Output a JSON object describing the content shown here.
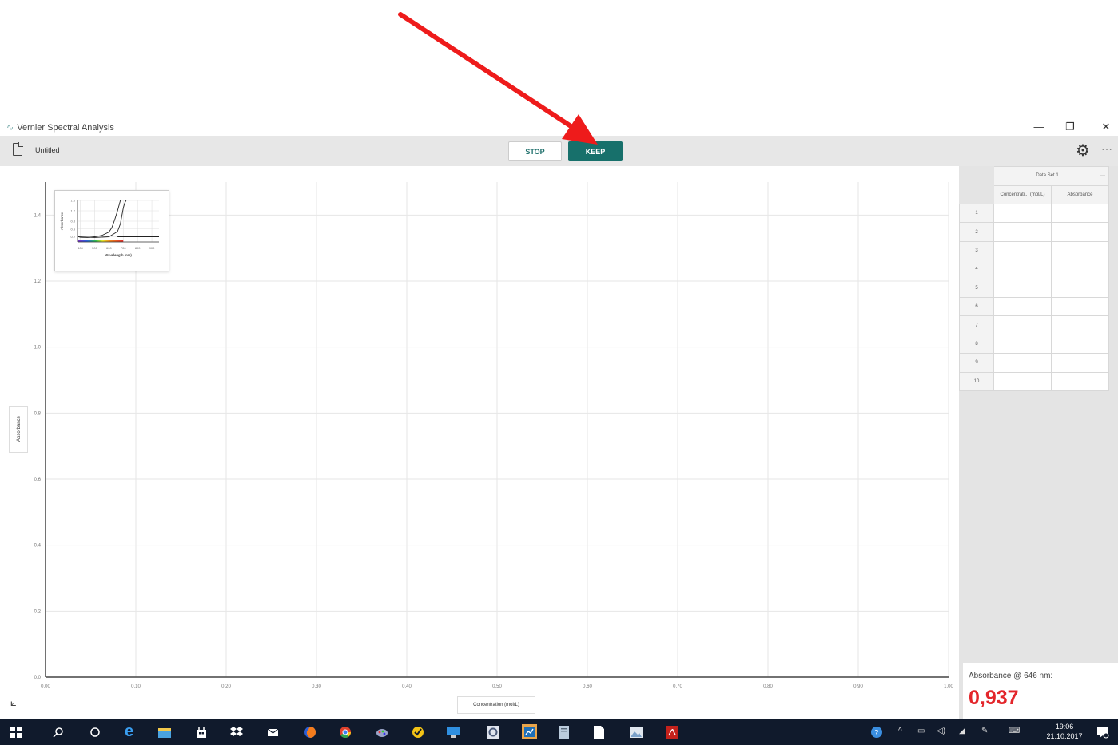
{
  "window": {
    "app_title": "Vernier Spectral Analysis",
    "minimize": "—",
    "maximize": "❐",
    "close": "✕"
  },
  "toolbar": {
    "doc_title": "Untitled",
    "stop_label": "STOP",
    "keep_label": "KEEP",
    "more_label": "⋯",
    "gear_icon": "⚙"
  },
  "graph": {
    "y_axis_label": "Absorbance",
    "x_axis_label": "Concentration (mol/L)",
    "y_ticks": [
      "0.0",
      "0.2",
      "0.4",
      "0.6",
      "0.8",
      "1.0",
      "1.2",
      "1.4"
    ],
    "x_ticks": [
      "0.00",
      "0.10",
      "0.20",
      "0.30",
      "0.40",
      "0.50",
      "0.60",
      "0.70",
      "0.80",
      "0.90",
      "1.00"
    ],
    "tool_icon": "⟀"
  },
  "chart_data": [
    {
      "type": "scatter",
      "xlabel": "Concentration (mol/L)",
      "ylabel": "Absorbance",
      "xlim": [
        0.0,
        1.0
      ],
      "ylim": [
        0.0,
        1.5
      ],
      "x_ticks": [
        "0.00",
        "0.10",
        "0.20",
        "0.30",
        "0.40",
        "0.50",
        "0.60",
        "0.70",
        "0.80",
        "0.90",
        "1.00"
      ],
      "y_ticks": [
        "0.0",
        "0.2",
        "0.4",
        "0.6",
        "0.8",
        "1.0",
        "1.2",
        "1.4"
      ],
      "grid": true,
      "series": []
    },
    {
      "type": "line",
      "xlabel": "Wavelength (nm)",
      "ylabel": "Absorbance",
      "xlim": [
        380,
        950
      ],
      "ylim": [
        0,
        1.6
      ],
      "x_ticks": [
        "400",
        "500",
        "600",
        "700",
        "800",
        "900"
      ],
      "y_ticks": [
        "0.2",
        "0.5",
        "0.8",
        "1.2",
        "1.6"
      ],
      "grid": true,
      "series": [
        {
          "x": [
            380,
            400,
            450,
            500,
            550,
            600,
            620,
            640,
            660,
            680
          ],
          "y": [
            0.22,
            0.18,
            0.17,
            0.2,
            0.25,
            0.38,
            0.55,
            0.85,
            1.2,
            1.6
          ]
        },
        {
          "x": [
            380,
            500,
            600,
            660,
            680,
            690,
            700,
            710,
            720
          ],
          "y": [
            0.2,
            0.17,
            0.2,
            0.4,
            0.7,
            1.0,
            1.3,
            1.5,
            1.6
          ]
        },
        {
          "x": [
            660,
            750,
            850,
            950
          ],
          "y": [
            0.2,
            0.2,
            0.2,
            0.2
          ]
        }
      ]
    }
  ],
  "table": {
    "dataset": "Data Set 1",
    "col1": "Concentrati... (mol/L)",
    "col2": "Absorbance",
    "menu": "⋯",
    "rows": [
      "1",
      "2",
      "3",
      "4",
      "5",
      "6",
      "7",
      "8",
      "9",
      "10"
    ]
  },
  "meter": {
    "label": "Absorbance @ 646 nm:",
    "value": "0,937"
  },
  "taskbar": {
    "time": "19:06",
    "date": "21.10.2017"
  },
  "colors": {
    "accent": "#17706b",
    "meter_value": "#e3262b",
    "annotation_arrow": "#ee1b1b",
    "taskbar": "#101a2c"
  }
}
